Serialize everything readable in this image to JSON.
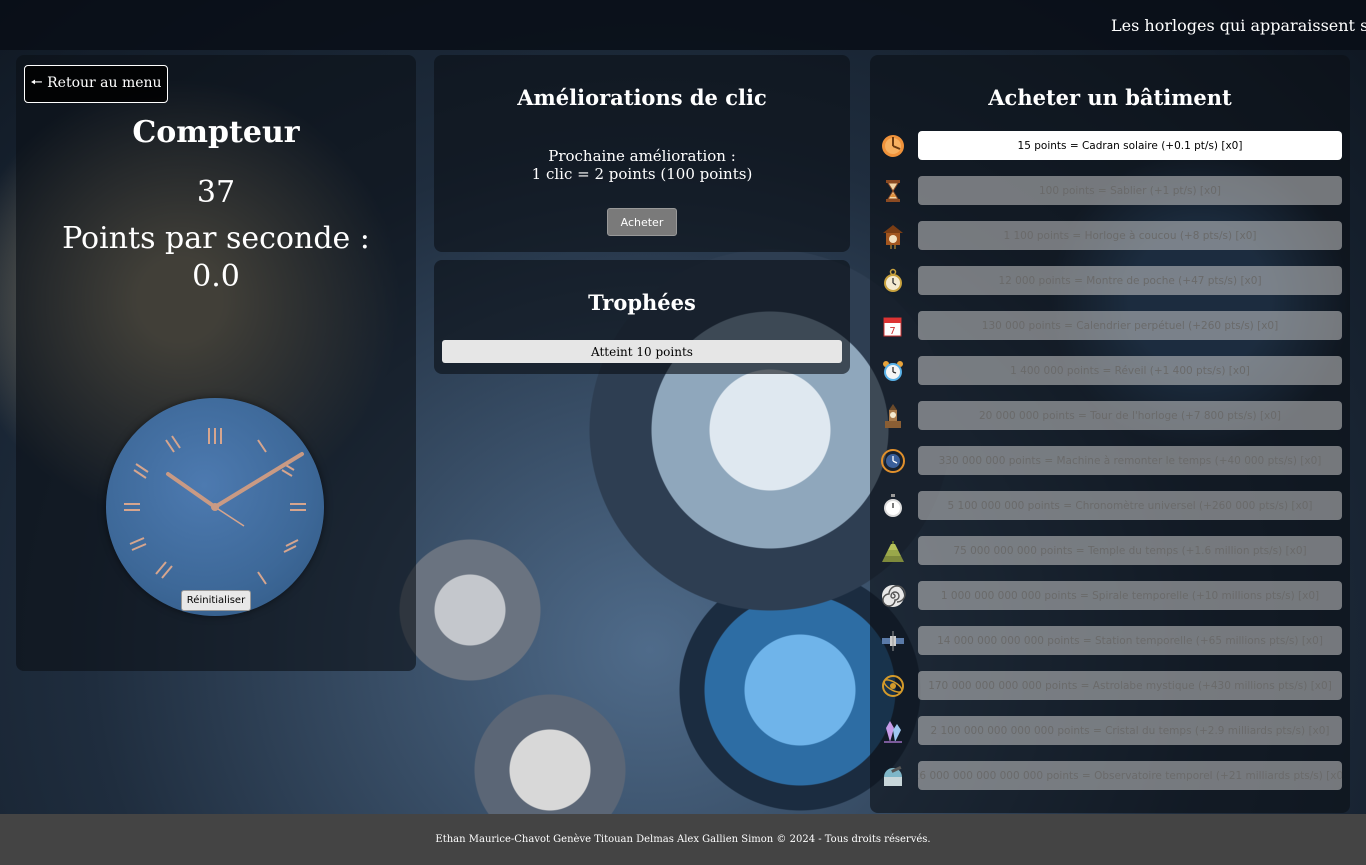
{
  "banner": {
    "text": "Les horloges qui apparaissent sur votre"
  },
  "counter_panel": {
    "back_label": "🠔 Retour au menu",
    "title": "Compteur",
    "count": "37",
    "pps_label": "Points par seconde :",
    "pps_value": "0.0",
    "reset_label": "Réinitialiser"
  },
  "upgrade_panel": {
    "title": "Améliorations de clic",
    "next_label": "Prochaine amélioration :",
    "next_value": "1 clic = 2 points (100 points)",
    "buy_label": "Acheter"
  },
  "trophy_panel": {
    "title": "Trophées",
    "items": [
      "Atteint 10 points"
    ]
  },
  "buildings_panel": {
    "title": "Acheter un bâtiment",
    "items": [
      {
        "label": "15 points = Cadran solaire (+0.1 pt/s) [x0]",
        "icon": "sundial-icon",
        "enabled": true
      },
      {
        "label": "100 points = Sablier (+1 pt/s) [x0]",
        "icon": "hourglass-icon",
        "enabled": false
      },
      {
        "label": "1 100 points = Horloge à coucou (+8 pts/s) [x0]",
        "icon": "cuckoo-clock-icon",
        "enabled": false
      },
      {
        "label": "12 000 points = Montre de poche (+47 pts/s) [x0]",
        "icon": "pocket-watch-icon",
        "enabled": false
      },
      {
        "label": "130 000 points = Calendrier perpétuel (+260 pts/s) [x0]",
        "icon": "calendar-icon",
        "enabled": false
      },
      {
        "label": "1 400 000 points = Réveil (+1 400 pts/s) [x0]",
        "icon": "alarm-clock-icon",
        "enabled": false
      },
      {
        "label": "20 000 000 points = Tour de l'horloge (+7 800 pts/s) [x0]",
        "icon": "clock-tower-icon",
        "enabled": false
      },
      {
        "label": "330 000 000 points = Machine à remonter le temps (+40 000 pts/s) [x0]",
        "icon": "time-machine-icon",
        "enabled": false
      },
      {
        "label": "5 100 000 000 points = Chronomètre universel (+260 000 pts/s) [x0]",
        "icon": "stopwatch-icon",
        "enabled": false
      },
      {
        "label": "75 000 000 000 points = Temple du temps (+1.6 million pts/s) [x0]",
        "icon": "temple-icon",
        "enabled": false
      },
      {
        "label": "1 000 000 000 000 points = Spirale temporelle (+10 millions pts/s) [x0]",
        "icon": "spiral-icon",
        "enabled": false
      },
      {
        "label": "14 000 000 000 000 points = Station temporelle (+65 millions pts/s) [x0]",
        "icon": "space-station-icon",
        "enabled": false
      },
      {
        "label": "170 000 000 000 000 points = Astrolabe mystique (+430 millions pts/s) [x0]",
        "icon": "astrolabe-icon",
        "enabled": false
      },
      {
        "label": "2 100 000 000 000 000 points = Cristal du temps (+2.9 milliards pts/s) [x0]",
        "icon": "crystal-icon",
        "enabled": false
      },
      {
        "label": "26 000 000 000 000 000 points = Observatoire temporel (+21 milliards pts/s) [x0]",
        "icon": "observatory-icon",
        "enabled": false
      }
    ]
  },
  "footer": {
    "text": "Ethan Maurice-Chavot Genève Titouan Delmas Alex Gallien Simon © 2024 - Tous droits réservés."
  },
  "colors": {
    "clock_face": "#3d6898",
    "clock_hands": "#c99a84",
    "footer_bg": "#444444"
  }
}
